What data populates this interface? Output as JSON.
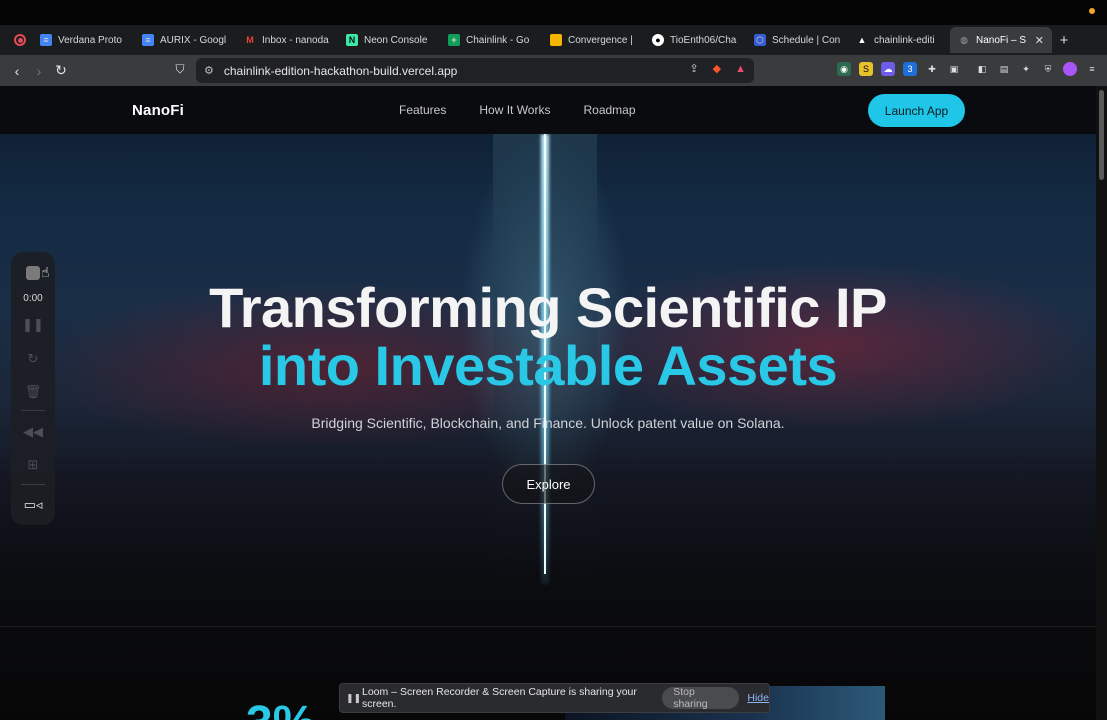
{
  "browser": {
    "tabs": [
      {
        "title": "Verdana Proto",
        "icon": "google-docs-icon",
        "color": "#4285f4"
      },
      {
        "title": "AURIX - Googl",
        "icon": "google-docs-icon",
        "color": "#4285f4"
      },
      {
        "title": "Inbox - nanoda",
        "icon": "gmail-icon",
        "color": "#ea4335"
      },
      {
        "title": "Neon Console",
        "icon": "neon-icon",
        "color": "#3ee8a6"
      },
      {
        "title": "Chainlink - Go",
        "icon": "google-sheets-icon",
        "color": "#0f9d58"
      },
      {
        "title": "Convergence |",
        "icon": "google-slides-icon",
        "color": "#f4b400"
      },
      {
        "title": "TioEnth06/Cha",
        "icon": "github-icon",
        "color": "#ffffff"
      },
      {
        "title": "Schedule | Con",
        "icon": "chainlink-icon",
        "color": "#375bd2"
      },
      {
        "title": "chainlink-editi",
        "icon": "vercel-icon",
        "color": "#ffffff"
      },
      {
        "title": "NanoFi – S",
        "icon": "globe-icon",
        "color": "#9aa0a6"
      }
    ],
    "url": "chainlink-edition-hackathon-build.vercel.app",
    "new_tab": "+",
    "ext_badge": "3"
  },
  "site": {
    "logo": "NanoFi",
    "nav": [
      "Features",
      "How It Works",
      "Roadmap"
    ],
    "cta": "Launch App",
    "hero_line1": "Transforming Scientific IP",
    "hero_line2": "into Investable Assets",
    "subtitle": "Bridging Scientific, Blockchain, and Finance. Unlock patent value on Solana.",
    "explore": "Explore",
    "stat_partial": "3%"
  },
  "loom": {
    "timer": "0:00",
    "share_text": "Loom – Screen Recorder & Screen Capture is sharing your screen.",
    "stop_sharing": "Stop sharing",
    "hide": "Hide"
  }
}
